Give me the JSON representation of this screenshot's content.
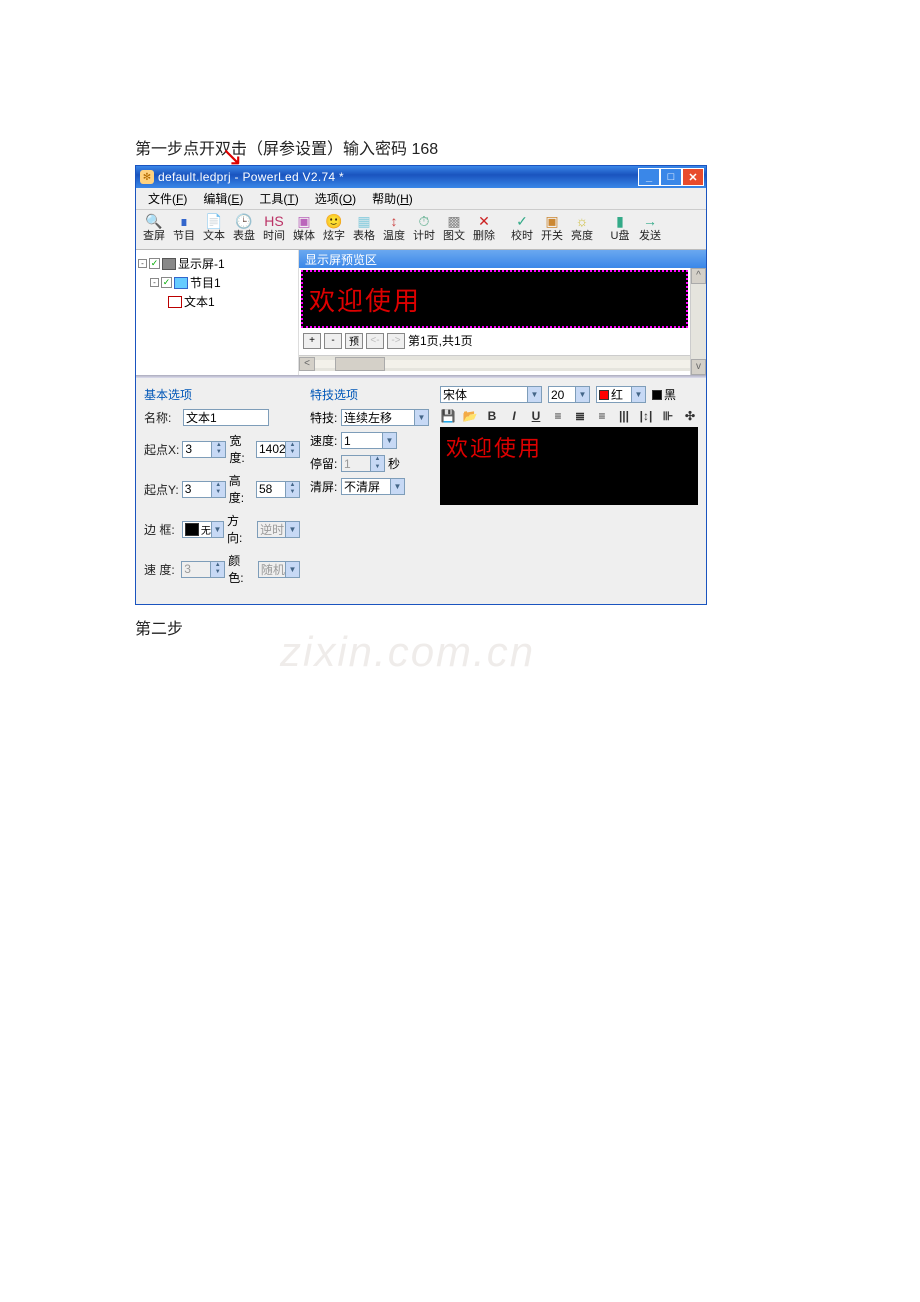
{
  "doc": {
    "line1": "第一步点开双击（屏参设置）输入密码 168",
    "line2": "第二步"
  },
  "window": {
    "title": "default.ledprj - PowerLed V2.74 *"
  },
  "menu": {
    "file": "文件",
    "file_u": "F",
    "edit": "编辑",
    "edit_u": "E",
    "tool": "工具",
    "tool_u": "T",
    "option": "选项",
    "option_u": "O",
    "help": "帮助",
    "help_u": "H"
  },
  "toolbar": {
    "items": [
      {
        "label": "查屏",
        "icon": "🔍",
        "c": "#5a8"
      },
      {
        "label": "节目",
        "icon": "∎",
        "c": "#36c"
      },
      {
        "label": "文本",
        "icon": "📄",
        "c": "#c83"
      },
      {
        "label": "表盘",
        "icon": "🕒",
        "c": "#c93"
      },
      {
        "label": "时间",
        "icon": "HS",
        "c": "#b36"
      },
      {
        "label": "媒体",
        "icon": "▣",
        "c": "#b6b"
      },
      {
        "label": "炫字",
        "icon": "🙂",
        "c": "#cb3"
      },
      {
        "label": "表格",
        "icon": "▦",
        "c": "#8cd"
      },
      {
        "label": "温度",
        "icon": "↕",
        "c": "#c44"
      },
      {
        "label": "计时",
        "icon": "⏱",
        "c": "#5a8"
      },
      {
        "label": "图文",
        "icon": "▩",
        "c": "#888"
      },
      {
        "label": "删除",
        "icon": "✕",
        "c": "#c22"
      },
      {
        "label": "",
        "icon": "",
        "sep": true
      },
      {
        "label": "校时",
        "icon": "✓",
        "c": "#3a8"
      },
      {
        "label": "开关",
        "icon": "▣",
        "c": "#c83"
      },
      {
        "label": "亮度",
        "icon": "☼",
        "c": "#cb3"
      },
      {
        "label": "",
        "icon": "",
        "sep": true
      },
      {
        "label": "U盘",
        "icon": "▮",
        "c": "#3a8"
      },
      {
        "label": "发送",
        "icon": "→",
        "c": "#3a8"
      }
    ]
  },
  "tree": {
    "screen": "显示屏-1",
    "program": "节目1",
    "text": "文本1"
  },
  "preview": {
    "header": "显示屏预览区",
    "welcome": "欢迎使用",
    "preview_btn": "预",
    "page_info": "第1页,共1页"
  },
  "basic": {
    "title": "基本选项",
    "name_l": "名称:",
    "name_v": "文本1",
    "sx_l": "起点X:",
    "sx_v": "3",
    "w_l": "宽度:",
    "w_v": "1402",
    "sy_l": "起点Y:",
    "sy_v": "3",
    "h_l": "高度:",
    "h_v": "58",
    "border_l": "边  框:",
    "border_v": "无",
    "dir_l": "方向:",
    "dir_v": "逆时",
    "speed_l": "速  度:",
    "speed_v": "3",
    "color_l": "颜色:",
    "color_v": "随机"
  },
  "tech": {
    "title": "特技选项",
    "eff_l": "特技:",
    "eff_v": "连续左移",
    "spd_l": "速度:",
    "spd_v": "1",
    "stay_l": "停留:",
    "stay_v": "1",
    "stay_unit": "秒",
    "clear_l": "清屏:",
    "clear_v": "不清屏"
  },
  "edit": {
    "font": "宋体",
    "size": "20",
    "fg": "红",
    "bg": "黑",
    "text": "欢迎使用"
  },
  "watermark": "zixin.com.cn"
}
